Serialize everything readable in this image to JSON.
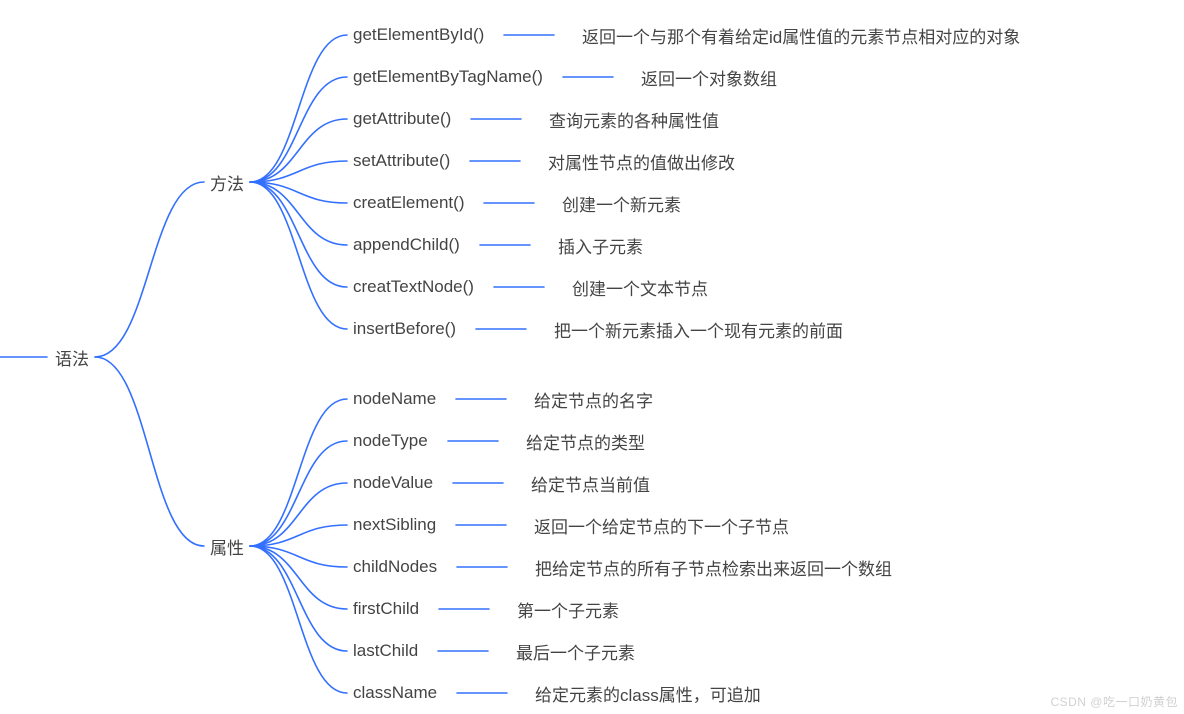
{
  "root": {
    "label": "语法"
  },
  "branches": [
    {
      "key": "methods",
      "label": "方法"
    },
    {
      "key": "properties",
      "label": "属性"
    }
  ],
  "methods": [
    {
      "name": "getElementById()",
      "desc": "返回一个与那个有着给定id属性值的元素节点相对应的对象"
    },
    {
      "name": "getElementByTagName()",
      "desc": "返回一个对象数组"
    },
    {
      "name": "getAttribute()",
      "desc": "查询元素的各种属性值"
    },
    {
      "name": "setAttribute()",
      "desc": "对属性节点的值做出修改"
    },
    {
      "name": "creatElement()",
      "desc": "创建一个新元素"
    },
    {
      "name": "appendChild()",
      "desc": "插入子元素"
    },
    {
      "name": "creatTextNode()",
      "desc": "创建一个文本节点"
    },
    {
      "name": "insertBefore()",
      "desc": "把一个新元素插入一个现有元素的前面"
    }
  ],
  "properties": [
    {
      "name": "nodeName",
      "desc": "给定节点的名字"
    },
    {
      "name": "nodeType",
      "desc": "给定节点的类型"
    },
    {
      "name": "nodeValue",
      "desc": "给定节点当前值"
    },
    {
      "name": "nextSibling",
      "desc": "返回一个给定节点的下一个子节点"
    },
    {
      "name": "childNodes",
      "desc": "把给定节点的所有子节点检索出来返回一个数组"
    },
    {
      "name": "firstChild",
      "desc": "第一个子元素"
    },
    {
      "name": "lastChild",
      "desc": "最后一个子元素"
    },
    {
      "name": "className",
      "desc": "给定元素的class属性，可追加"
    }
  ],
  "watermark": "CSDN @吃一口奶黄包",
  "chart_data": {
    "type": "tree",
    "title": "",
    "root": "语法",
    "children": [
      {
        "label": "方法",
        "children": [
          {
            "label": "getElementById()",
            "desc": "返回一个与那个有着给定id属性值的元素节点相对应的对象"
          },
          {
            "label": "getElementByTagName()",
            "desc": "返回一个对象数组"
          },
          {
            "label": "getAttribute()",
            "desc": "查询元素的各种属性值"
          },
          {
            "label": "setAttribute()",
            "desc": "对属性节点的值做出修改"
          },
          {
            "label": "creatElement()",
            "desc": "创建一个新元素"
          },
          {
            "label": "appendChild()",
            "desc": "插入子元素"
          },
          {
            "label": "creatTextNode()",
            "desc": "创建一个文本节点"
          },
          {
            "label": "insertBefore()",
            "desc": "把一个新元素插入一个现有元素的前面"
          }
        ]
      },
      {
        "label": "属性",
        "children": [
          {
            "label": "nodeName",
            "desc": "给定节点的名字"
          },
          {
            "label": "nodeType",
            "desc": "给定节点的类型"
          },
          {
            "label": "nodeValue",
            "desc": "给定节点当前值"
          },
          {
            "label": "nextSibling",
            "desc": "返回一个给定节点的下一个子节点"
          },
          {
            "label": "childNodes",
            "desc": "把给定节点的所有子节点检索出来返回一个数组"
          },
          {
            "label": "firstChild",
            "desc": "第一个子元素"
          },
          {
            "label": "lastChild",
            "desc": "最后一个子元素"
          },
          {
            "label": "className",
            "desc": "给定元素的class属性，可追加"
          }
        ]
      }
    ]
  }
}
